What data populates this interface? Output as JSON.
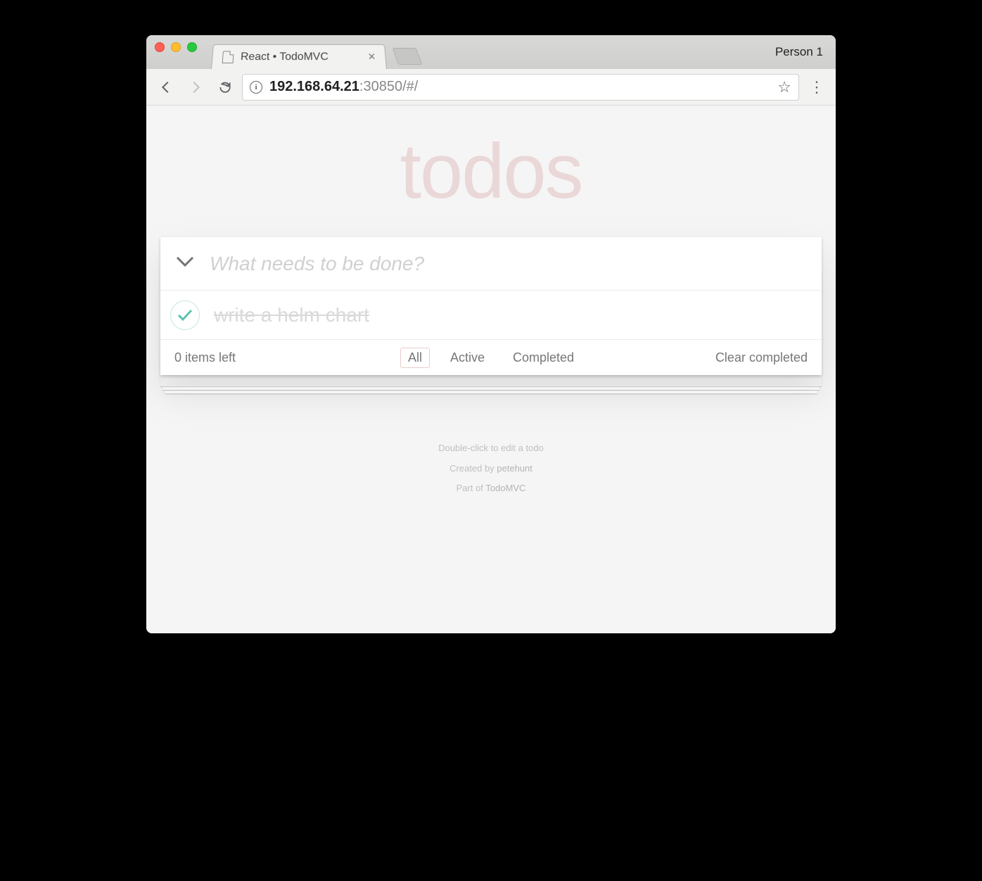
{
  "browser": {
    "tab_title": "React • TodoMVC",
    "profile": "Person 1",
    "url_host": "192.168.64.21",
    "url_rest": ":30850/#/"
  },
  "app": {
    "title": "todos",
    "input_placeholder": "What needs to be done?",
    "items": [
      {
        "label": "write a helm chart",
        "completed": true
      }
    ],
    "footer": {
      "count_text": "0 items left",
      "filters": {
        "all": "All",
        "active": "Active",
        "completed": "Completed"
      },
      "active_filter": "all",
      "clear": "Clear completed"
    }
  },
  "info": {
    "line1": "Double-click to edit a todo",
    "created_prefix": "Created by ",
    "created_link": "petehunt",
    "partof_prefix": "Part of ",
    "partof_link": "TodoMVC"
  }
}
